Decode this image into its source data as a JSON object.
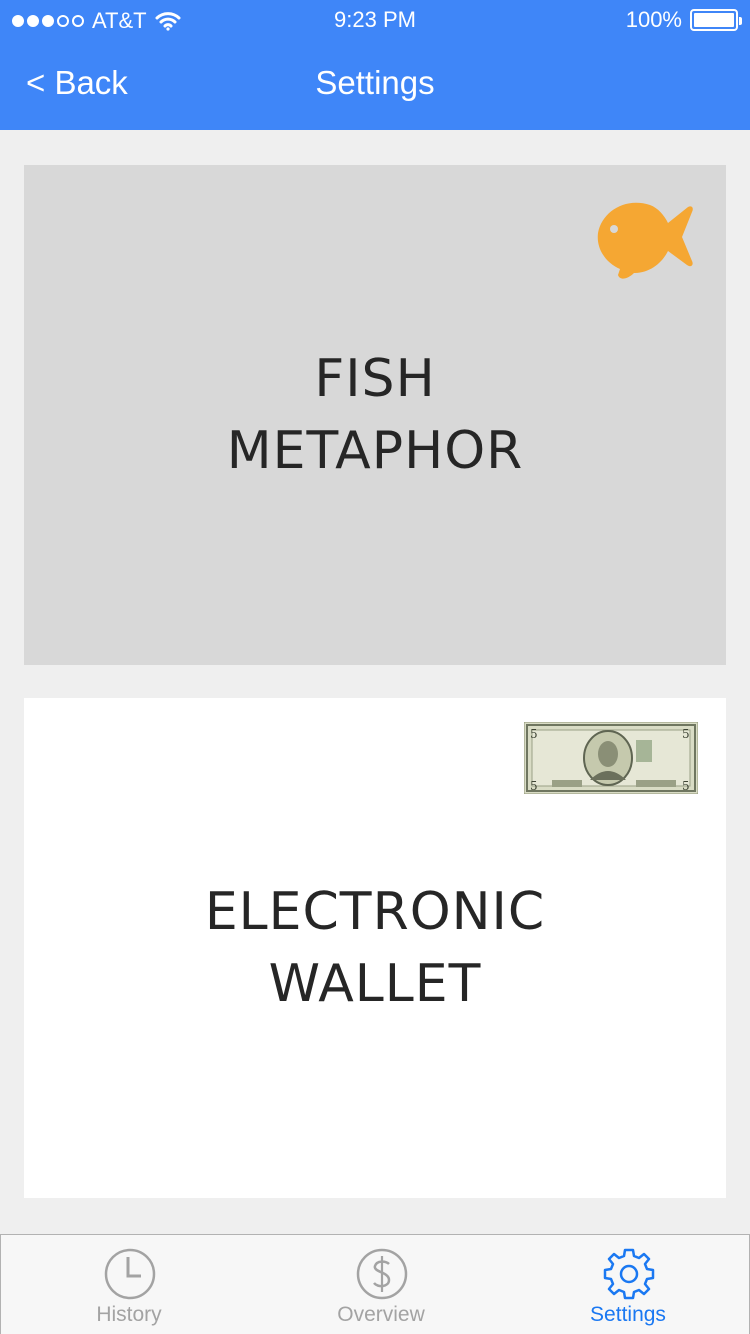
{
  "status_bar": {
    "carrier": "AT&T",
    "time": "9:23 PM",
    "battery": "100%"
  },
  "nav": {
    "back_label": "< Back",
    "title": "Settings"
  },
  "options": [
    {
      "label": "FISH\nMETAPHOR",
      "icon": "fish-icon",
      "selected": true
    },
    {
      "label": "ELECTRONIC\nWALLET",
      "icon": "five-dollar-bill-icon",
      "selected": false
    }
  ],
  "tabbar": {
    "tabs": [
      {
        "label": "History",
        "icon": "clock-icon",
        "active": false
      },
      {
        "label": "Overview",
        "icon": "dollar-circle-icon",
        "active": false
      },
      {
        "label": "Settings",
        "icon": "gear-icon",
        "active": true
      }
    ]
  },
  "colors": {
    "accent": "#3f86f8",
    "tab_active": "#1a78f2",
    "tab_inactive": "#a3a3a3",
    "fish": "#f5a733",
    "selected_card": "#d8d8d8"
  }
}
